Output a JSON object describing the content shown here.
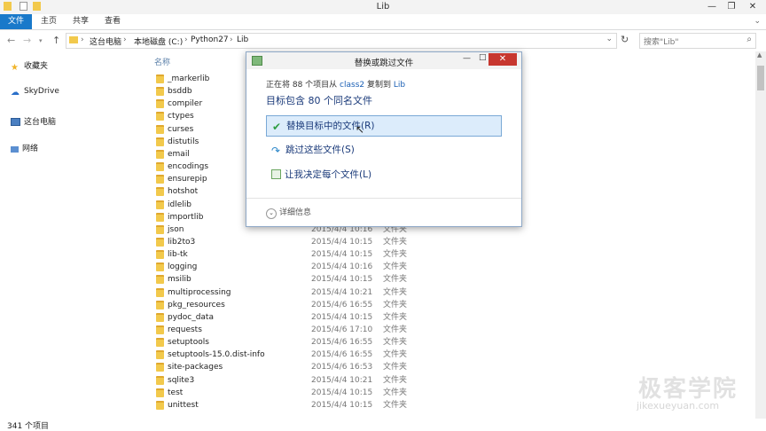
{
  "window": {
    "title": "Lib",
    "controls": [
      "—",
      "❐",
      "✕"
    ]
  },
  "ribbon": {
    "tabs": [
      "文件",
      "主页",
      "共享",
      "查看"
    ]
  },
  "address": {
    "crumbs": [
      "这台电脑",
      "本地磁盘 (C:)",
      "Python27",
      "Lib"
    ],
    "search_placeholder": "搜索\"Lib\""
  },
  "nav_pane": {
    "items": [
      {
        "label": "收藏夹",
        "icon": "star-icon"
      },
      {
        "label": "SkyDrive",
        "icon": "cloud-icon"
      },
      {
        "label": "这台电脑",
        "icon": "computer-icon"
      },
      {
        "label": "网络",
        "icon": "network-icon"
      }
    ]
  },
  "list": {
    "column_name": "名称",
    "rows": [
      {
        "name": "_markerlib",
        "date": "",
        "type": ""
      },
      {
        "name": "bsddb",
        "date": "",
        "type": ""
      },
      {
        "name": "compiler",
        "date": "",
        "type": ""
      },
      {
        "name": "ctypes",
        "date": "",
        "type": ""
      },
      {
        "name": "curses",
        "date": "",
        "type": ""
      },
      {
        "name": "distutils",
        "date": "",
        "type": ""
      },
      {
        "name": "email",
        "date": "",
        "type": ""
      },
      {
        "name": "encodings",
        "date": "",
        "type": ""
      },
      {
        "name": "ensurepip",
        "date": "",
        "type": ""
      },
      {
        "name": "hotshot",
        "date": "",
        "type": ""
      },
      {
        "name": "idlelib",
        "date": "",
        "type": ""
      },
      {
        "name": "importlib",
        "date": "",
        "type": ""
      },
      {
        "name": "json",
        "date": "2015/4/4 10:16",
        "type": "文件夹"
      },
      {
        "name": "lib2to3",
        "date": "2015/4/4 10:15",
        "type": "文件夹"
      },
      {
        "name": "lib-tk",
        "date": "2015/4/4 10:15",
        "type": "文件夹"
      },
      {
        "name": "logging",
        "date": "2015/4/4 10:16",
        "type": "文件夹"
      },
      {
        "name": "msilib",
        "date": "2015/4/4 10:15",
        "type": "文件夹"
      },
      {
        "name": "multiprocessing",
        "date": "2015/4/4 10:21",
        "type": "文件夹"
      },
      {
        "name": "pkg_resources",
        "date": "2015/4/6 16:55",
        "type": "文件夹"
      },
      {
        "name": "pydoc_data",
        "date": "2015/4/4 10:15",
        "type": "文件夹"
      },
      {
        "name": "requests",
        "date": "2015/4/6 17:10",
        "type": "文件夹"
      },
      {
        "name": "setuptools",
        "date": "2015/4/6 16:55",
        "type": "文件夹"
      },
      {
        "name": "setuptools-15.0.dist-info",
        "date": "2015/4/6 16:55",
        "type": "文件夹"
      },
      {
        "name": "site-packages",
        "date": "2015/4/6 16:53",
        "type": "文件夹"
      },
      {
        "name": "sqlite3",
        "date": "2015/4/4 10:21",
        "type": "文件夹"
      },
      {
        "name": "test",
        "date": "2015/4/4 10:15",
        "type": "文件夹"
      },
      {
        "name": "unittest",
        "date": "2015/4/4 10:15",
        "type": "文件夹"
      }
    ]
  },
  "status": {
    "count": "341 个项目"
  },
  "dialog": {
    "title": "替换或跳过文件",
    "progress_prefix": "正在将 88 个项目从 ",
    "source": "class2",
    "progress_mid": " 复制到 ",
    "dest": "Lib",
    "heading": "目标包含 80 个同名文件",
    "options": [
      {
        "label": "替换目标中的文件(R)",
        "icon": "check-icon",
        "selected": true
      },
      {
        "label": "跳过这些文件(S)",
        "icon": "skip-icon",
        "selected": false
      },
      {
        "label": "让我决定每个文件(L)",
        "icon": "choose-icon",
        "selected": false
      }
    ],
    "details": "详细信息",
    "close": "✕",
    "minimize": "—",
    "maximize": "□"
  },
  "watermark": {
    "brand": "极客学院",
    "url": "jikexueyuan.com"
  },
  "colors": {
    "accent": "#1979ca",
    "folder": "#f2c94c",
    "close_red": "#c7372f",
    "link_blue": "#1a3a7a"
  }
}
